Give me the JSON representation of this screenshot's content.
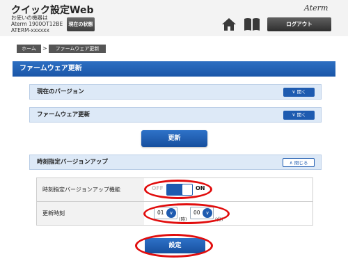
{
  "header": {
    "app_title": "クイック設定Web",
    "device_line1": "お使いの機器は",
    "device_line2": "Aterm 1900OT12BE",
    "device_line3": "ATERM-xxxxxx",
    "status_button": "現在の状態",
    "brand": "Aterm",
    "logout_button": "ログアウト",
    "icons": [
      "home-icon",
      "book-icon"
    ]
  },
  "breadcrumb": {
    "home": "ホーム",
    "separator": ">",
    "current": "ファームウェア更新"
  },
  "page": {
    "title": "ファームウェア更新"
  },
  "sections": {
    "current_version": {
      "label": "現在のバージョン",
      "button": "開く"
    },
    "firmware_update": {
      "label": "ファームウェア更新",
      "button": "開く"
    },
    "update_button": "更新",
    "scheduled": {
      "label": "時刻指定バージョンアップ",
      "button": "閉じる"
    }
  },
  "settings": {
    "feature_label": "時刻指定バージョンアップ機能",
    "toggle_off": "OFF",
    "toggle_on": "ON",
    "toggle_state": "ON",
    "time_label": "更新時刻",
    "hour_value": "01",
    "hour_unit": "(時)",
    "minute_value": "00",
    "minute_unit": "(分)"
  },
  "set_button": "設定",
  "colors": {
    "accent_blue": "#1e5bb0",
    "section_bg": "#dde9f7",
    "annotation_red": "#e10d0d"
  }
}
